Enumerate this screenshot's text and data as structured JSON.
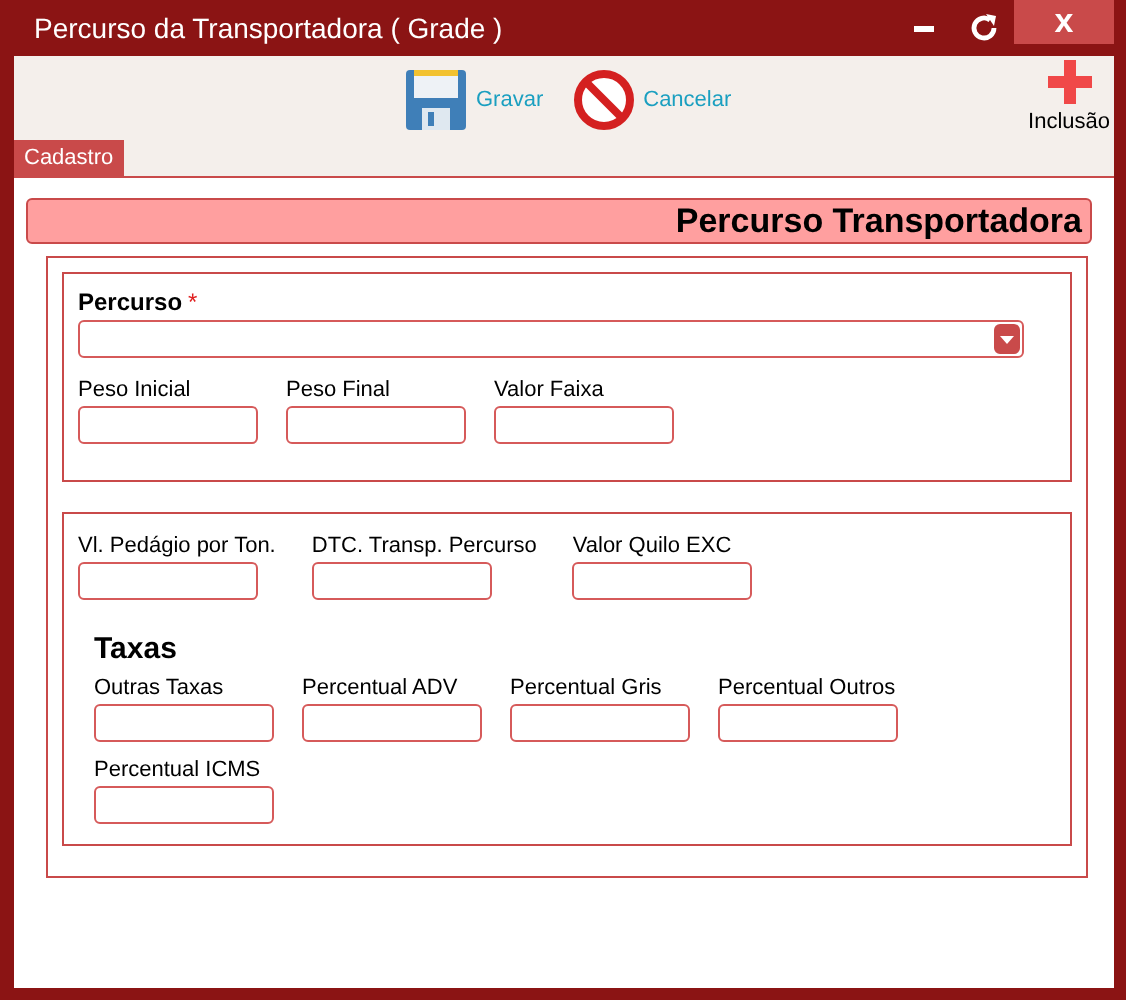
{
  "window": {
    "title": "Percurso da Transportadora ( Grade )",
    "close_label": "x"
  },
  "toolbar": {
    "buttons": [
      {
        "kind": "save",
        "label": "Gravar"
      },
      {
        "kind": "cancel",
        "label": "Cancelar"
      }
    ],
    "add": {
      "label": "Inclusão"
    }
  },
  "tabs": [
    {
      "label": "Cadastro",
      "selected": true
    }
  ],
  "header": "Percurso Transportadora",
  "section_1": {
    "select": {
      "label": "Percurso",
      "required_mark": "*"
    },
    "fields": [
      {
        "label": "Peso Inicial"
      },
      {
        "label": "Peso Final"
      },
      {
        "label": "Valor Faixa"
      }
    ]
  },
  "section_2": {
    "fields": [
      {
        "label": "Vl. Pedágio por Ton."
      },
      {
        "label": "DTC. Transp. Percurso"
      },
      {
        "label": "Valor Quilo EXC"
      }
    ],
    "group": {
      "title": "Taxas",
      "fields": [
        {
          "label": "Outras Taxas"
        },
        {
          "label": "Percentual ADV"
        },
        {
          "label": "Percentual Gris"
        },
        {
          "label": "Percentual Outros"
        },
        {
          "label": "Percentual ICMS"
        }
      ]
    }
  }
}
